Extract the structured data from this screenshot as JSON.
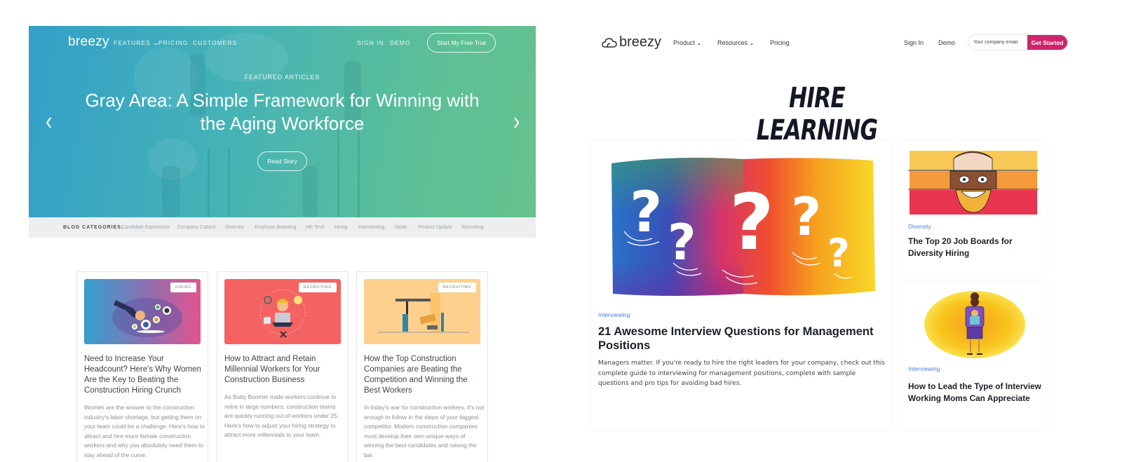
{
  "old_blog": {
    "logo": "breezy",
    "nav": {
      "features": "FEATURES",
      "pricing": "PRICING",
      "customers": "CUSTOMERS",
      "sign_in": "SIGN IN",
      "demo": "DEMO",
      "cta": "Start My Free Trial"
    },
    "hero": {
      "eyebrow": "FEATURED ARTICLES",
      "title": "Gray Area: A Simple Framework for Winning with the Aging Workforce",
      "button": "Read Story",
      "prev_icon": "chevron-left",
      "next_icon": "chevron-right"
    },
    "categories": {
      "label": "BLOG CATEGORIES:",
      "items": [
        "Candidate Experience",
        "Company Culture",
        "Diversity",
        "Employer Branding",
        "HR Tech",
        "Hiring",
        "Interviewing",
        "News",
        "Product Update",
        "Recruiting"
      ]
    },
    "cards": [
      {
        "badge": "HIRING",
        "title": "Need to Increase Your Headcount? Here's Why Women Are the Key to Beating the Construction Hiring Crunch",
        "body": "Women are the answer to the construction industry's labor shortage, but getting them on your team could be a challenge. Here's how to attract and hire more female construction workers and why you absolutely need them to stay ahead of the curve."
      },
      {
        "badge": "RECRUITING",
        "title": "How to Attract and Retain Millennial Workers for Your Construction Business",
        "body": "As Baby Boomer trade workers continue to retire in large numbers, construction teams are quickly running out of workers under 25. Here's how to adjust your hiring strategy to attract more millennials to your team."
      },
      {
        "badge": "RECRUITING",
        "title": "How the Top Construction Companies are Beating the Competition and Winning the Best Workers",
        "body": "In today's war for construction workers, it's not enough to follow in the steps of your biggest competitor. Modern construction companies must develop their own unique ways of winning the best candidates and raising the bar."
      }
    ]
  },
  "new_blog": {
    "logo": "breezy",
    "nav": {
      "product": "Product",
      "resources": "Resources",
      "pricing": "Pricing",
      "sign_in": "Sign In",
      "demo": "Demo",
      "email_placeholder": "Your company email",
      "cta": "Get Started"
    },
    "heading": "HIRE LEARNING",
    "featured": {
      "tag": "Interviewing",
      "title": "21 Awesome Interview Questions for Management Positions",
      "body": "Managers matter. If you're ready to hire the right leaders for your company, check out this complete guide to interviewing for management positions, complete with sample questions and pro tips for avoiding bad hires."
    },
    "side_articles": [
      {
        "tag": "Diversity",
        "title": "The Top 20 Job Boards for Diversity Hiring"
      },
      {
        "tag": "Interviewing",
        "title": "How to Lead the Type of Interview Working Moms Can Appreciate"
      }
    ],
    "colors": {
      "accent": "#d0246b",
      "tag": "#4a7fd8"
    }
  }
}
